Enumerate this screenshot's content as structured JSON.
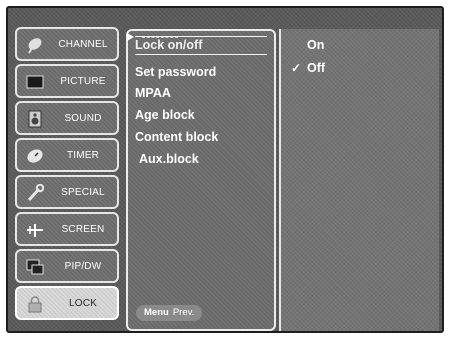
{
  "sidebar": {
    "items": [
      {
        "label": "CHANNEL",
        "icon": "satellite-dish-icon"
      },
      {
        "label": "PICTURE",
        "icon": "tv-screen-icon"
      },
      {
        "label": "SOUND",
        "icon": "speaker-icon"
      },
      {
        "label": "TIMER",
        "icon": "clock-icon"
      },
      {
        "label": "SPECIAL",
        "icon": "wrench-icon"
      },
      {
        "label": "SCREEN",
        "icon": "crosshair-icon"
      },
      {
        "label": "PIP/DW",
        "icon": "pip-windows-icon"
      },
      {
        "label": "LOCK",
        "icon": "padlock-icon",
        "active": true
      }
    ]
  },
  "lock_menu": {
    "items": [
      {
        "label": "Lock on/off",
        "selected": true
      },
      {
        "label": "Set password"
      },
      {
        "label": "MPAA"
      },
      {
        "label": "Age block"
      },
      {
        "label": "Content block"
      },
      {
        "label": "Aux.block"
      }
    ],
    "footer": {
      "menu_key": "Menu",
      "prev_label": "Prev."
    }
  },
  "options": {
    "items": [
      {
        "label": "On",
        "checked": false
      },
      {
        "label": "Off",
        "checked": true
      }
    ],
    "check_mark": "✓"
  }
}
